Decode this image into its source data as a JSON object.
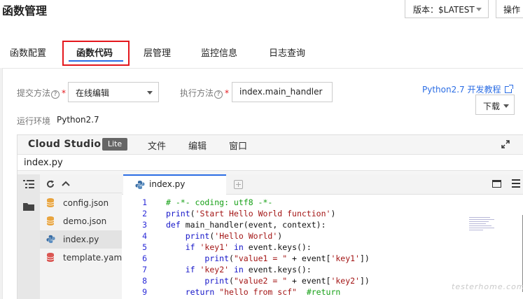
{
  "header": {
    "title": "函数管理",
    "version_label": "版本：$LATEST",
    "ops_label": "操作"
  },
  "tabs": [
    {
      "label": "函数配置"
    },
    {
      "label": "函数代码"
    },
    {
      "label": "层管理"
    },
    {
      "label": "监控信息"
    },
    {
      "label": "日志查询"
    }
  ],
  "form": {
    "submit_method_label": "提交方法",
    "submit_method_value": "在线编辑",
    "exec_method_label": "执行方法",
    "exec_method_value": "index.main_handler",
    "doc_link": "Python2.7 开发教程",
    "download_label": "下载",
    "runtime_label": "运行环境",
    "runtime_value": "Python2.7",
    "help_glyph": "?",
    "required_mark": "*"
  },
  "ide": {
    "logo": "Cloud Studio",
    "badge": "Lite",
    "menu": [
      "文件",
      "编辑",
      "窗口"
    ],
    "path": "index.py",
    "files": [
      {
        "name": "config.json",
        "icon": "database-icon",
        "color": "#e8a33c"
      },
      {
        "name": "demo.json",
        "icon": "database-icon",
        "color": "#e8a33c"
      },
      {
        "name": "index.py",
        "icon": "python-icon",
        "color": "#3a6ea5"
      },
      {
        "name": "template.yaml",
        "icon": "database-icon",
        "color": "#d9534f"
      }
    ],
    "active_tab": "index.py",
    "code_lines": [
      {
        "n": "1",
        "text": "# -*- coding: utf8 -*-"
      },
      {
        "n": "2",
        "text": "print('Start Hello World function')"
      },
      {
        "n": "3",
        "text": "def main_handler(event, context):"
      },
      {
        "n": "4",
        "text": "    print('Hello World')"
      },
      {
        "n": "5",
        "text": "    if 'key1' in event.keys():"
      },
      {
        "n": "6",
        "text": "        print(\"value1 = \" + event['key1'])"
      },
      {
        "n": "7",
        "text": "    if 'key2' in event.keys():"
      },
      {
        "n": "8",
        "text": "        print(\"value2 = \" + event['key2'])"
      },
      {
        "n": "9",
        "text": "    return \"hello from scf\"  #return"
      }
    ]
  },
  "watermark": "testerhome.com",
  "colors": {
    "accent": "#2b6de4",
    "highlight_box": "#e4171d",
    "required": "#e4171d"
  }
}
